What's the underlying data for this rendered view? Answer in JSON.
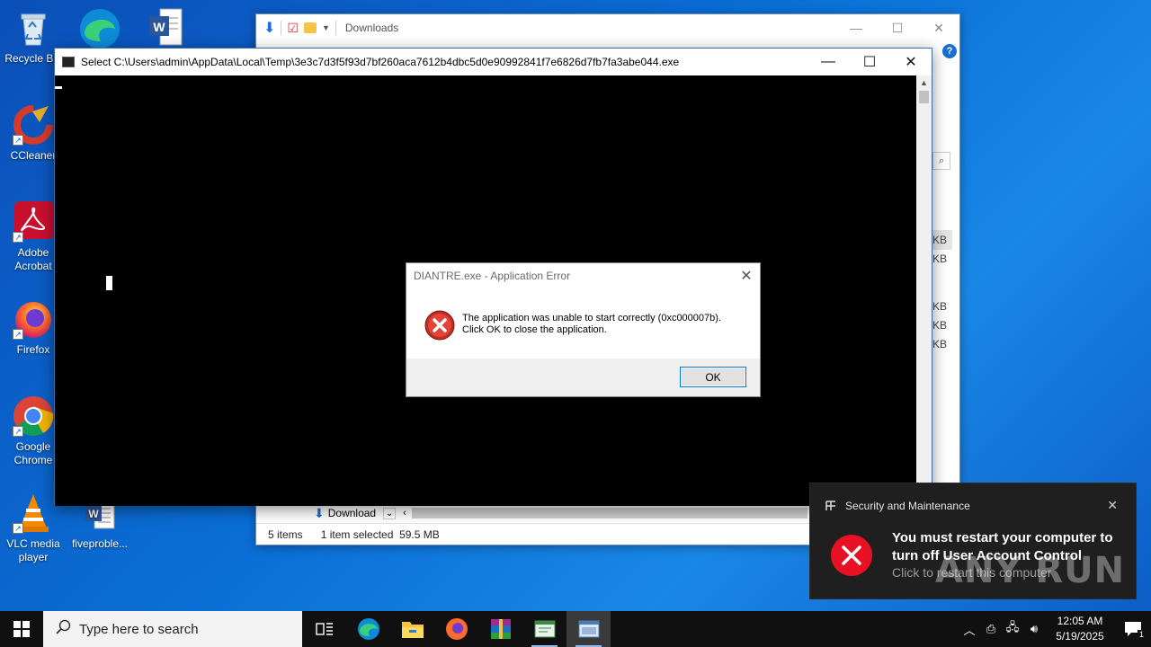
{
  "desktop": {
    "icons": [
      {
        "label": "Recycle Bin",
        "icon": "recycle-bin-icon"
      },
      {
        "label": "CCleaner",
        "icon": "ccleaner-icon"
      },
      {
        "label": "Adobe Acrobat",
        "icon": "adobe-acrobat-icon"
      },
      {
        "label": "Firefox",
        "icon": "firefox-icon"
      },
      {
        "label": "Google Chrome",
        "icon": "chrome-icon"
      },
      {
        "label": "VLC media player",
        "icon": "vlc-icon"
      },
      {
        "label": "fiveproble...",
        "icon": "word-document-icon"
      }
    ]
  },
  "explorer": {
    "title": "Downloads",
    "status_items": "5 items",
    "status_selected": "1 item selected",
    "status_size": "59.5 MB",
    "nav_item": "Download",
    "kb_labels": [
      "KB",
      "KB",
      "KB",
      "KB",
      "KB"
    ]
  },
  "console": {
    "title": "Select C:\\Users\\admin\\AppData\\Local\\Temp\\3e3c7d3f5f93d7bf260aca7612b4dbc5d0e90992841f7e6826d7fb7fa3abe044.exe"
  },
  "error_dialog": {
    "title": "DIANTRE.exe - Application Error",
    "line1": "The application was unable to start correctly (0xc000007b).",
    "line2": "Click OK to close the application.",
    "ok_label": "OK"
  },
  "toast": {
    "source": "Security and Maintenance",
    "message": "You must restart your computer to turn off User Account Control",
    "sub": "Click to restart this computer",
    "watermark": "ANY RUN"
  },
  "taskbar": {
    "search_placeholder": "Type here to search",
    "time": "12:05 AM",
    "date": "5/19/2025",
    "notification_count": "1"
  },
  "colors": {
    "error_red": "#e81123",
    "accent": "#0078d7",
    "toast_bg": "#1f1f1f"
  }
}
